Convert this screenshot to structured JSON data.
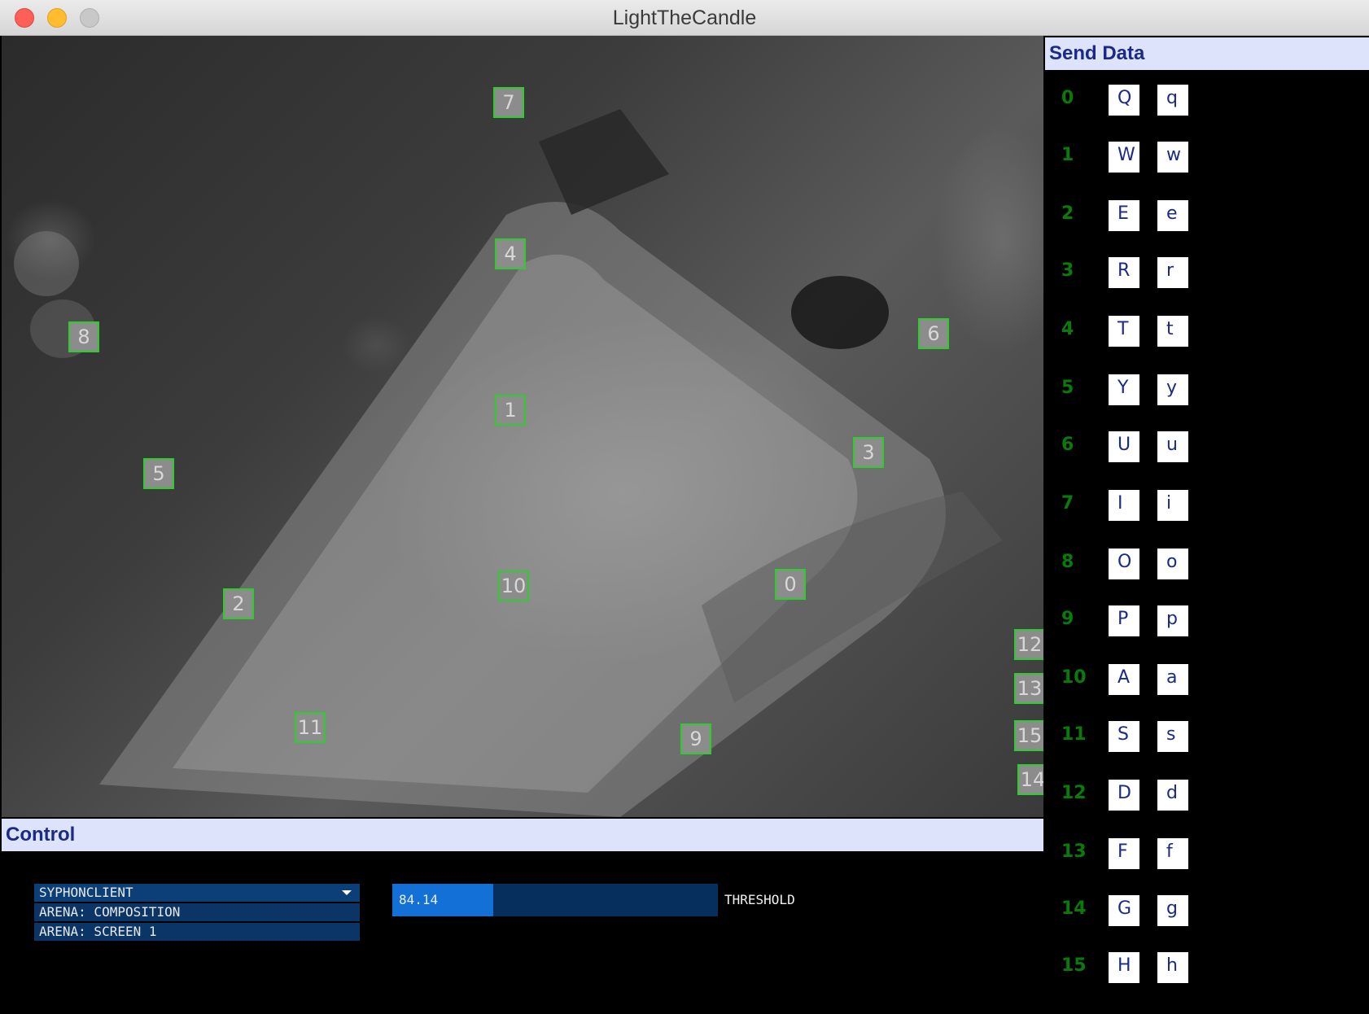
{
  "window": {
    "title": "LightTheCandle"
  },
  "markers": [
    {
      "label": "7"
    },
    {
      "label": "4"
    },
    {
      "label": "8"
    },
    {
      "label": "6"
    },
    {
      "label": "1"
    },
    {
      "label": "3"
    },
    {
      "label": "5"
    },
    {
      "label": "10"
    },
    {
      "label": "0"
    },
    {
      "label": "2"
    },
    {
      "label": "12"
    },
    {
      "label": "13"
    },
    {
      "label": "11"
    },
    {
      "label": "9"
    },
    {
      "label": "15"
    },
    {
      "label": "14"
    }
  ],
  "send_data": {
    "title": "Send Data",
    "rows": [
      {
        "index": "0",
        "upper": "Q",
        "lower": "q"
      },
      {
        "index": "1",
        "upper": "W",
        "lower": "w"
      },
      {
        "index": "2",
        "upper": "E",
        "lower": "e"
      },
      {
        "index": "3",
        "upper": "R",
        "lower": "r"
      },
      {
        "index": "4",
        "upper": "T",
        "lower": "t"
      },
      {
        "index": "5",
        "upper": "Y",
        "lower": "y"
      },
      {
        "index": "6",
        "upper": "U",
        "lower": "u"
      },
      {
        "index": "7",
        "upper": "I",
        "lower": "i"
      },
      {
        "index": "8",
        "upper": "O",
        "lower": "o"
      },
      {
        "index": "9",
        "upper": "P",
        "lower": "p"
      },
      {
        "index": "10",
        "upper": "A",
        "lower": "a"
      },
      {
        "index": "11",
        "upper": "S",
        "lower": "s"
      },
      {
        "index": "12",
        "upper": "D",
        "lower": "d"
      },
      {
        "index": "13",
        "upper": "F",
        "lower": "f"
      },
      {
        "index": "14",
        "upper": "G",
        "lower": "g"
      },
      {
        "index": "15",
        "upper": "H",
        "lower": "h"
      }
    ]
  },
  "control": {
    "title": "Control",
    "source_list": {
      "selected": "SYPHONCLIENT",
      "options": [
        "ARENA: COMPOSITION",
        "ARENA: SCREEN 1"
      ]
    },
    "threshold": {
      "value": "84.14",
      "label": "THRESHOLD",
      "fill_fraction": 0.31
    }
  },
  "colors": {
    "marker_border": "#2ecc2e",
    "panel_header_bg": "#dde3fb",
    "panel_header_text": "#1a2a8a",
    "row_label": "#0a7a0a",
    "slider_fill": "#1270d6",
    "slider_bg": "#062f5e"
  }
}
